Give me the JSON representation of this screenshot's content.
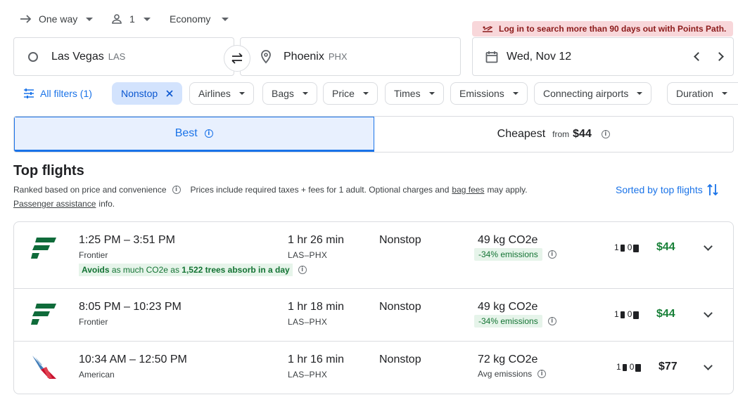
{
  "search": {
    "trip_type": "One way",
    "passengers": "1",
    "cabin": "Economy",
    "origin": {
      "city": "Las Vegas",
      "code": "LAS"
    },
    "destination": {
      "city": "Phoenix",
      "code": "PHX"
    },
    "date": "Wed, Nov 12"
  },
  "banner": {
    "text": "Log in to search more than 90 days out with Points Path."
  },
  "filters": {
    "all_filters": "All filters (1)",
    "nonstop": "Nonstop",
    "airlines": "Airlines",
    "bags": "Bags",
    "price": "Price",
    "times": "Times",
    "emissions": "Emissions",
    "connecting": "Connecting airports",
    "duration": "Duration"
  },
  "tabs": {
    "best": "Best",
    "cheapest": "Cheapest",
    "cheapest_from": "from",
    "cheapest_price": "$44"
  },
  "results": {
    "title": "Top flights",
    "ranked": "Ranked based on price and convenience",
    "prices_prefix": "Prices include required taxes + fees for 1 adult. Optional charges and",
    "bag_fees": "bag fees",
    "prices_suffix": "may apply.",
    "passenger_assistance": "Passenger assistance",
    "info_suffix": "info.",
    "sorted": "Sorted by top flights"
  },
  "flights": [
    {
      "times": "1:25 PM – 3:51 PM",
      "airline": "Frontier",
      "duration": "1 hr 26 min",
      "route": "LAS–PHX",
      "stops": "Nonstop",
      "co2": "49 kg CO2e",
      "emissions": "-34% emissions",
      "carry_on": "1",
      "checked": "0",
      "price": "$44",
      "avoids_pre": "Avoids",
      "avoids_mid": "as much CO2e as",
      "avoids_bold": "1,522 trees absorb in a day"
    },
    {
      "times": "8:05 PM – 10:23 PM",
      "airline": "Frontier",
      "duration": "1 hr 18 min",
      "route": "LAS–PHX",
      "stops": "Nonstop",
      "co2": "49 kg CO2e",
      "emissions": "-34% emissions",
      "carry_on": "1",
      "checked": "0",
      "price": "$44"
    },
    {
      "times": "10:34 AM – 12:50 PM",
      "airline": "American",
      "duration": "1 hr 16 min",
      "route": "LAS–PHX",
      "stops": "Nonstop",
      "co2": "72 kg CO2e",
      "emissions": "Avg emissions",
      "carry_on": "1",
      "checked": "0",
      "price": "$77"
    }
  ]
}
